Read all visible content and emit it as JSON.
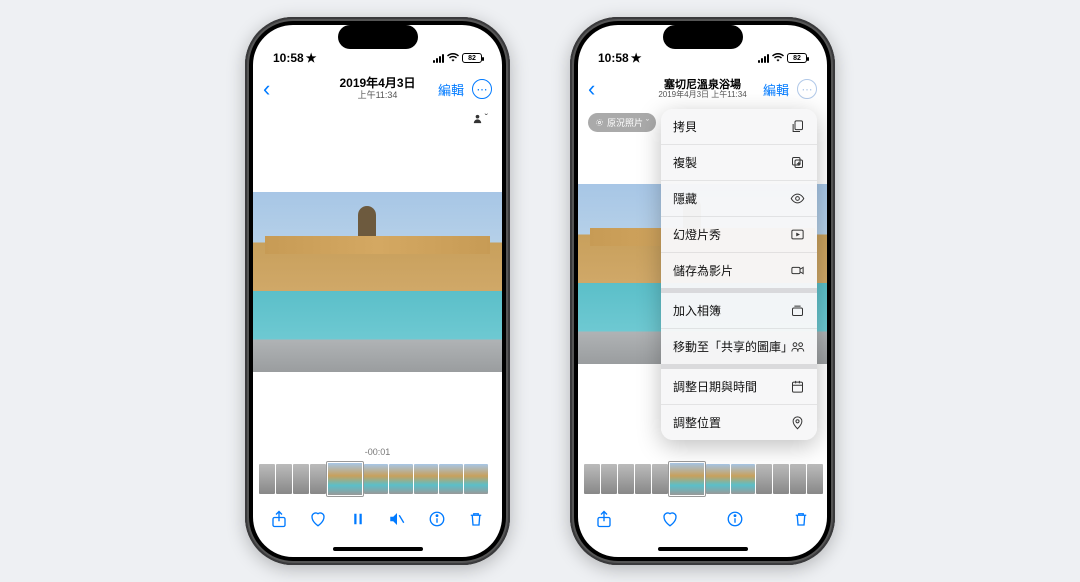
{
  "status": {
    "time": "10:58",
    "star": "★",
    "battery": "82"
  },
  "left": {
    "title_line1": "2019年4月3日",
    "title_line2": "上午11:34",
    "edit_label": "編輯",
    "timestamp": "-00:01"
  },
  "right": {
    "title_line1": "塞切尼溫泉浴場",
    "title_line2": "2019年4月3日 上午11:34",
    "edit_label": "編輯",
    "live_badge": "原況照片",
    "menu": [
      {
        "label": "拷貝",
        "icon": "copy"
      },
      {
        "label": "複製",
        "icon": "duplicate"
      },
      {
        "label": "隱藏",
        "icon": "eye"
      },
      {
        "label": "幻燈片秀",
        "icon": "play-rect"
      },
      {
        "label": "儲存為影片",
        "icon": "video"
      },
      {
        "label": "加入相簿",
        "icon": "album",
        "group": true
      },
      {
        "label": "移動至「共享的圖庫」",
        "icon": "shared"
      },
      {
        "label": "調整日期與時間",
        "icon": "calendar",
        "group": true
      },
      {
        "label": "調整位置",
        "icon": "location"
      }
    ]
  }
}
